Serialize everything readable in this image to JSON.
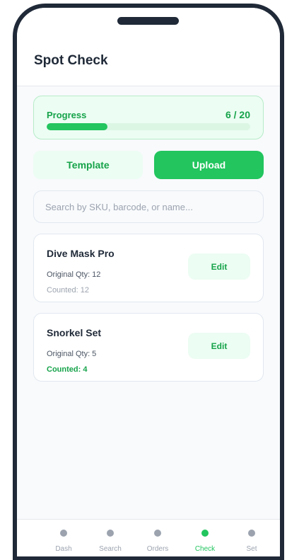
{
  "app": {
    "title": "Spot Check"
  },
  "progress": {
    "label": "Progress",
    "count_text": "6 / 20",
    "value": 6,
    "total": 20,
    "fraction": 0.3
  },
  "actions": {
    "template_label": "Template",
    "upload_label": "Upload"
  },
  "search": {
    "placeholder": "Search by SKU, barcode, or name...",
    "value": ""
  },
  "items": [
    {
      "name": "Dive Mask Pro",
      "original": "Original Qty: 12",
      "counted": "Counted: 12",
      "counted_changed": false,
      "edit_label": "Edit"
    },
    {
      "name": "Snorkel Set",
      "original": "Original Qty: 5",
      "counted": "Counted: 4",
      "counted_changed": true,
      "edit_label": "Edit"
    }
  ],
  "tabs": [
    {
      "label": "Dash",
      "active": false
    },
    {
      "label": "Search",
      "active": false
    },
    {
      "label": "Orders",
      "active": false
    },
    {
      "label": "Check",
      "active": true
    },
    {
      "label": "Set",
      "active": false
    }
  ],
  "colors": {
    "accent": "#22c55e",
    "accent_text": "#16a34a",
    "accent_bg": "#ecfdf3",
    "frame": "#1f2937",
    "inactive": "#9ca3af"
  }
}
